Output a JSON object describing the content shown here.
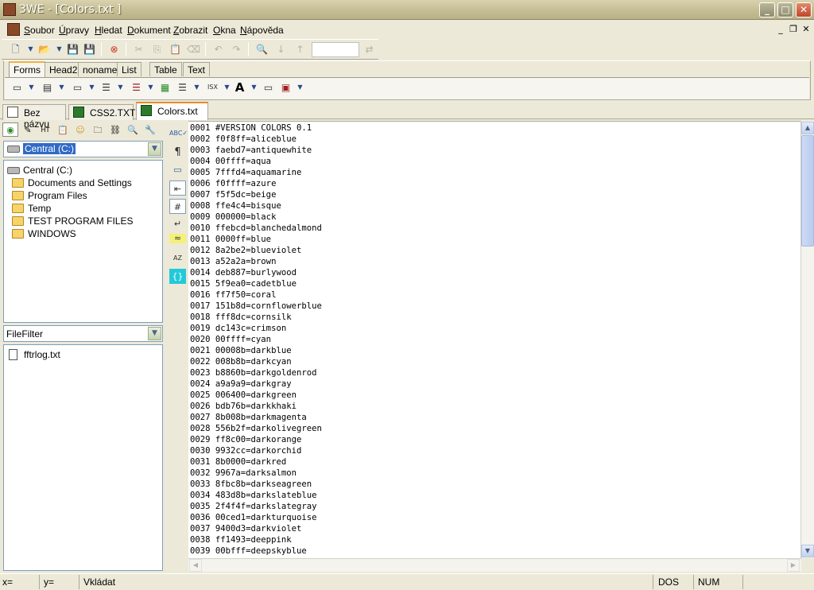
{
  "window": {
    "title": "3WE - [Colors.txt  ]",
    "minimize": "_",
    "maximize": "□",
    "close": "✕"
  },
  "menubar": {
    "items": [
      "Soubor",
      "Úpravy",
      "Hledat",
      "Dokument",
      "Zobrazit",
      "Okna",
      "Nápověda"
    ],
    "mdi_minimize": "_",
    "mdi_restore": "❐",
    "mdi_close": "✕"
  },
  "tag_tabs": [
    "Forms",
    "Head2",
    "noname",
    "List",
    "Table",
    "Text"
  ],
  "doc_tabs": [
    "Bez názvu",
    "CSS2.TXT",
    "Colors.txt"
  ],
  "left_pane": {
    "drive": "Central (C:)",
    "tree": [
      {
        "label": "Central (C:)",
        "type": "drive"
      },
      {
        "label": "Documents and Settings",
        "type": "folder"
      },
      {
        "label": "Program Files",
        "type": "folder"
      },
      {
        "label": "Temp",
        "type": "folder"
      },
      {
        "label": "TEST PROGRAM FILES",
        "type": "folder"
      },
      {
        "label": "WINDOWS",
        "type": "folder"
      }
    ],
    "filter": "FileFilter",
    "files": [
      "fftrlog.txt"
    ]
  },
  "editor": {
    "lines": [
      {
        "n": "0001",
        "text": "#VERSION COLORS 0.1"
      },
      {
        "n": "0002",
        "text": "f0f8ff=aliceblue"
      },
      {
        "n": "0003",
        "text": "faebd7=antiquewhite"
      },
      {
        "n": "0004",
        "text": "00ffff=aqua"
      },
      {
        "n": "0005",
        "text": "7fffd4=aquamarine"
      },
      {
        "n": "0006",
        "text": "f0ffff=azure"
      },
      {
        "n": "0007",
        "text": "f5f5dc=beige"
      },
      {
        "n": "0008",
        "text": "ffe4c4=bisque"
      },
      {
        "n": "0009",
        "text": "000000=black"
      },
      {
        "n": "0010",
        "text": "ffebcd=blanchedalmond"
      },
      {
        "n": "0011",
        "text": "0000ff=blue"
      },
      {
        "n": "0012",
        "text": "8a2be2=blueviolet"
      },
      {
        "n": "0013",
        "text": "a52a2a=brown"
      },
      {
        "n": "0014",
        "text": "deb887=burlywood"
      },
      {
        "n": "0015",
        "text": "5f9ea0=cadetblue"
      },
      {
        "n": "0016",
        "text": "ff7f50=coral"
      },
      {
        "n": "0017",
        "text": "151b8d=cornflowerblue"
      },
      {
        "n": "0018",
        "text": "fff8dc=cornsilk"
      },
      {
        "n": "0019",
        "text": "dc143c=crimson"
      },
      {
        "n": "0020",
        "text": "00ffff=cyan"
      },
      {
        "n": "0021",
        "text": "00008b=darkblue"
      },
      {
        "n": "0022",
        "text": "008b8b=darkcyan"
      },
      {
        "n": "0023",
        "text": "b8860b=darkgoldenrod"
      },
      {
        "n": "0024",
        "text": "a9a9a9=darkgray"
      },
      {
        "n": "0025",
        "text": "006400=darkgreen"
      },
      {
        "n": "0026",
        "text": "bdb76b=darkkhaki"
      },
      {
        "n": "0027",
        "text": "8b008b=darkmagenta"
      },
      {
        "n": "0028",
        "text": "556b2f=darkolivegreen"
      },
      {
        "n": "0029",
        "text": "ff8c00=darkorange"
      },
      {
        "n": "0030",
        "text": "9932cc=darkorchid"
      },
      {
        "n": "0031",
        "text": "8b0000=darkred"
      },
      {
        "n": "0032",
        "text": "9967a=darksalmon"
      },
      {
        "n": "0033",
        "text": "8fbc8b=darkseagreen"
      },
      {
        "n": "0034",
        "text": "483d8b=darkslateblue"
      },
      {
        "n": "0035",
        "text": "2f4f4f=darkslategray"
      },
      {
        "n": "0036",
        "text": "00ced1=darkturquoise"
      },
      {
        "n": "0037",
        "text": "9400d3=darkviolet"
      },
      {
        "n": "0038",
        "text": "ff1493=deeppink"
      },
      {
        "n": "0039",
        "text": "00bfff=deepskyblue"
      }
    ]
  },
  "statusbar": {
    "x": "x=",
    "y": "y=",
    "mode": "Vkládat",
    "line_ending": "DOS",
    "numlock": "NUM"
  }
}
